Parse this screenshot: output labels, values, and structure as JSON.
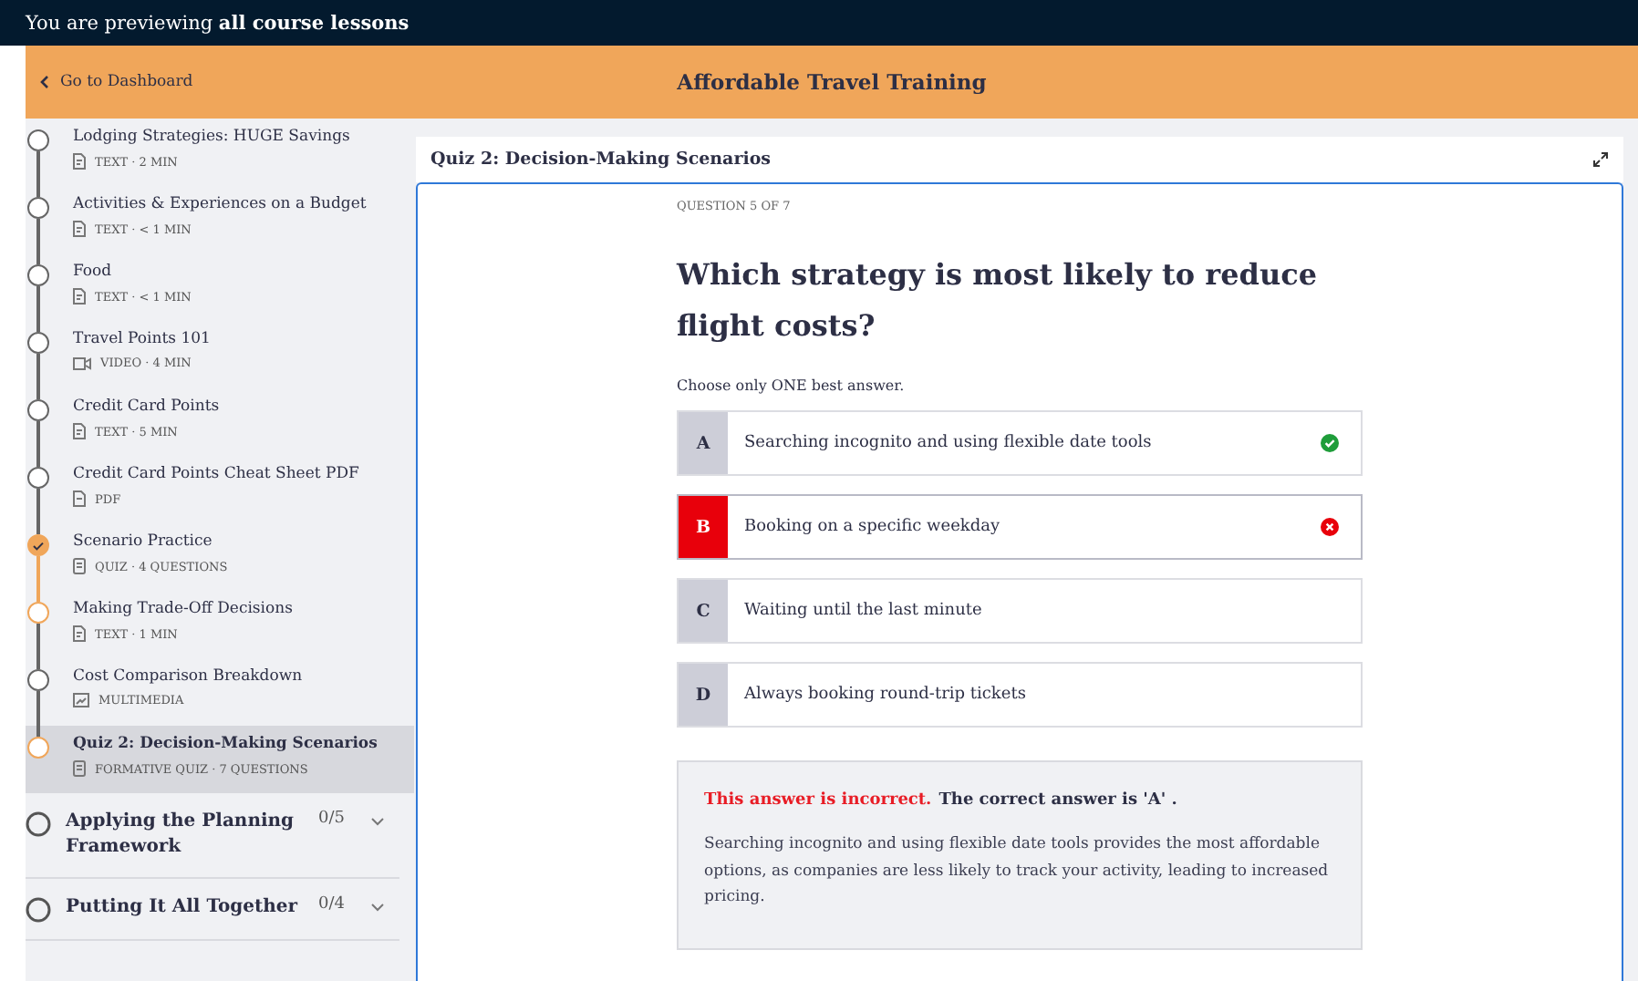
{
  "preview_banner": {
    "text": "You are previewing **all course lessons**"
  },
  "header": {
    "back_link": "Go to Dashboard",
    "title": "Affordable Travel Training"
  },
  "sidebar": {
    "lessons": [
      {
        "title": "Lodging Strategies: HUGE Savings",
        "kind": "text",
        "meta": "TEXT · 2 MIN",
        "completed": false,
        "in_progress": false,
        "selected": false
      },
      {
        "title": "Activities & Experiences on a Budget",
        "kind": "text",
        "meta": "TEXT · < 1 MIN",
        "completed": false,
        "in_progress": false,
        "selected": false
      },
      {
        "title": "Food",
        "kind": "text",
        "meta": "TEXT · < 1 MIN",
        "completed": false,
        "in_progress": false,
        "selected": false
      },
      {
        "title": "Travel Points 101",
        "kind": "video",
        "meta": "VIDEO · 4 MIN",
        "completed": false,
        "in_progress": false,
        "selected": false
      },
      {
        "title": "Credit Card Points",
        "kind": "text",
        "meta": "TEXT · 5 MIN",
        "completed": false,
        "in_progress": false,
        "selected": false
      },
      {
        "title": "Credit Card Points Cheat Sheet PDF",
        "kind": "pdf",
        "meta": "PDF",
        "completed": false,
        "in_progress": false,
        "selected": false
      },
      {
        "title": "Scenario Practice",
        "kind": "quiz",
        "meta": "QUIZ · 4 QUESTIONS",
        "completed": true,
        "in_progress": false,
        "selected": false
      },
      {
        "title": "Making Trade-Off Decisions",
        "kind": "text",
        "meta": "TEXT · 1 MIN",
        "completed": false,
        "in_progress": true,
        "selected": false
      },
      {
        "title": "Cost Comparison Breakdown",
        "kind": "multimedia",
        "meta": "MULTIMEDIA",
        "completed": false,
        "in_progress": false,
        "selected": false
      },
      {
        "title": "Quiz 2: Decision-Making Scenarios",
        "kind": "quiz",
        "meta": "FORMATIVE QUIZ · 7 QUESTIONS",
        "completed": false,
        "in_progress": true,
        "selected": true
      }
    ],
    "sections": [
      {
        "title": "Applying the Planning Framework",
        "progress": "0/5",
        "level": 0,
        "expanded": false
      },
      {
        "title": "Putting It All Together",
        "progress": "0/4",
        "level": 0,
        "expanded": false
      }
    ]
  },
  "quiz": {
    "title": "Quiz 2: Decision-Making Scenarios",
    "counter": "QUESTION 5 OF 7",
    "question": "Which strategy is most likely to reduce flight costs?",
    "hint": "Choose only ONE best answer.",
    "options": [
      {
        "letter": "A",
        "text": "Searching incognito and using flexible date tools",
        "selected": false,
        "correct": true
      },
      {
        "letter": "B",
        "text": "Booking on a specific weekday",
        "selected": true,
        "correct": false
      },
      {
        "letter": "C",
        "text": "Waiting until the last minute",
        "selected": false,
        "correct": false
      },
      {
        "letter": "D",
        "text": "Always booking round-trip tickets",
        "selected": false,
        "correct": false
      }
    ],
    "feedback": {
      "verdict": "This answer is incorrect.",
      "answer": "The correct answer is 'A' .",
      "explanation": "Searching incognito and using flexible date tools provides the most affordable options, as companies are less likely to track your activity, leading to increased pricing."
    }
  }
}
